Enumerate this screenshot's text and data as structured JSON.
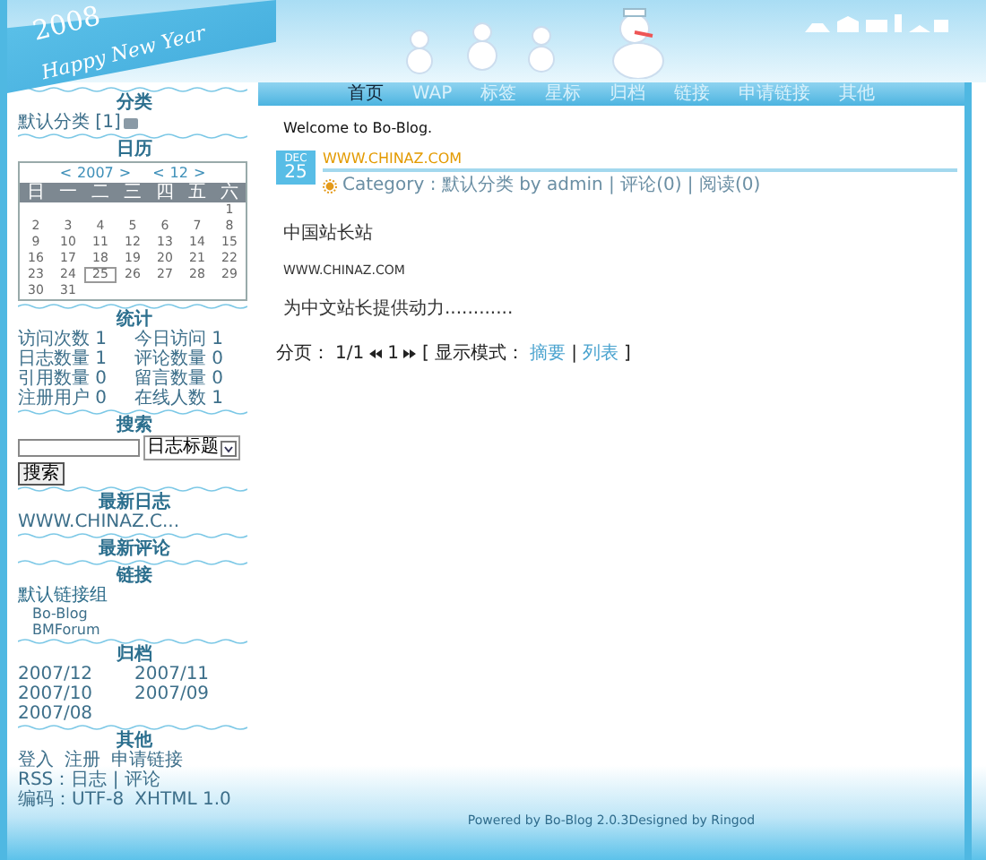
{
  "header": {
    "year": "2008",
    "greeting": "Happy New Year"
  },
  "nav": [
    {
      "label": "首页",
      "selected": true
    },
    {
      "label": "WAP",
      "selected": false
    },
    {
      "label": "标签",
      "selected": false
    },
    {
      "label": "星标",
      "selected": false
    },
    {
      "label": "归档",
      "selected": false
    },
    {
      "label": "链接",
      "selected": false
    },
    {
      "label": "申请链接",
      "selected": false
    },
    {
      "label": "其他",
      "selected": false
    }
  ],
  "sidebar": [
    {
      "kind": "category",
      "title": "分类",
      "items": [
        "默认分类 [1]"
      ]
    },
    {
      "kind": "calendar",
      "title": "日历",
      "prev": "<",
      "next": ">",
      "year": "2007",
      "month": "12",
      "weekdays": [
        "日",
        "一",
        "二",
        "三",
        "四",
        "五",
        "六"
      ],
      "weeks": [
        [
          {
            "day": "1",
            "selected": false
          }
        ],
        [
          {
            "day": "2",
            "selected": false
          },
          {
            "day": "3",
            "selected": false
          },
          {
            "day": "4",
            "selected": false
          },
          {
            "day": "5",
            "selected": false
          },
          {
            "day": "6",
            "selected": false
          },
          {
            "day": "7",
            "selected": false
          },
          {
            "day": "8",
            "selected": false
          }
        ],
        [
          {
            "day": "9",
            "selected": false
          },
          {
            "day": "10",
            "selected": false
          },
          {
            "day": "11",
            "selected": false
          },
          {
            "day": "12",
            "selected": false
          },
          {
            "day": "13",
            "selected": false
          },
          {
            "day": "14",
            "selected": false
          },
          {
            "day": "15",
            "selected": false
          }
        ],
        [
          {
            "day": "16",
            "selected": false
          },
          {
            "day": "17",
            "selected": false
          },
          {
            "day": "18",
            "selected": false
          },
          {
            "day": "19",
            "selected": false
          },
          {
            "day": "20",
            "selected": false
          },
          {
            "day": "21",
            "selected": false
          },
          {
            "day": "22",
            "selected": false
          }
        ],
        [
          {
            "day": "23",
            "selected": false
          },
          {
            "day": "24",
            "selected": false
          },
          {
            "day": "25",
            "selected": true
          },
          {
            "day": "26",
            "selected": false
          },
          {
            "day": "27",
            "selected": false
          },
          {
            "day": "28",
            "selected": false
          },
          {
            "day": "29",
            "selected": false
          }
        ],
        [
          {
            "day": "30",
            "selected": false
          },
          {
            "day": "31",
            "selected": false
          }
        ]
      ]
    },
    {
      "kind": "grid",
      "title": "统计",
      "items": [
        "访问次数 1",
        "今日访问 1",
        "日志数量 1",
        "评论数量 0",
        "引用数量 0",
        "留言数量 0",
        "注册用户 0",
        "在线人数 1"
      ]
    },
    {
      "kind": "search",
      "title": "搜索",
      "select": "日志标题",
      "button": "搜索"
    },
    {
      "kind": "list",
      "title": "最新日志",
      "items": [
        "WWW.CHINAZ.C..."
      ]
    },
    {
      "kind": "list",
      "title": "最新评论"
    },
    {
      "kind": "links",
      "title": "链接",
      "groups": [
        {
          "name": "默认链接组",
          "links": [
            "Bo-Blog",
            "BMForum"
          ]
        }
      ]
    },
    {
      "kind": "grid",
      "title": "归档",
      "items": [
        "2007/12",
        "2007/11",
        "2007/10",
        "2007/09",
        "2007/08"
      ]
    },
    {
      "kind": "wrap",
      "title": "其他",
      "items": [
        "登入",
        "注册",
        "申请链接",
        "RSS：日志 | 评论",
        "编码：UTF-8",
        "XHTML 1.0"
      ]
    }
  ],
  "main": {
    "welcome": "Welcome to Bo-Blog.",
    "post": {
      "month": "DEC",
      "day": "25",
      "title": "WWW.CHINAZ.COM",
      "meta": "Category : 默认分类 by admin | 评论(0) | 阅读(0)",
      "body": [
        "中国站长站",
        "WWW.CHINAZ.COM",
        "为中文站长提供动力............"
      ]
    },
    "paging": {
      "label": "分页：",
      "pages": "1/1",
      "current": "1",
      "mode_label": "[ 显示模式：",
      "modes": [
        "摘要",
        "列表"
      ],
      "separator": "|",
      "end": "]"
    },
    "footer": "Powered by Bo-Blog 2.0.3Designed by Ringod"
  }
}
